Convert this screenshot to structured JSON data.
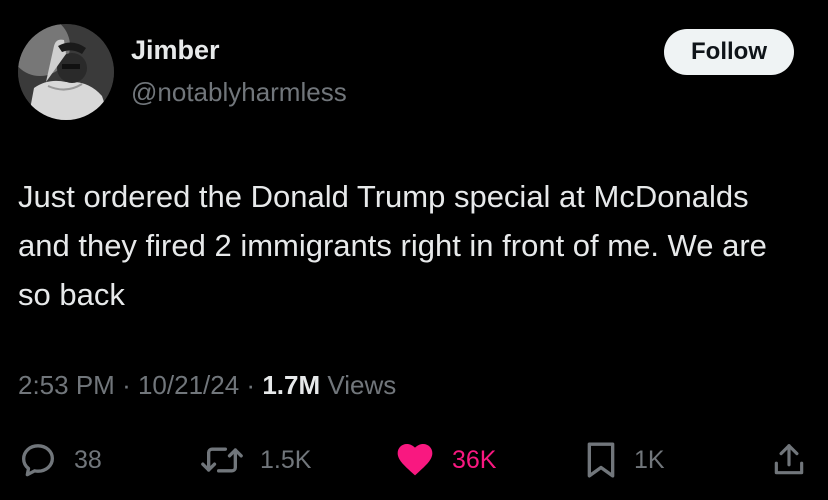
{
  "author": {
    "name": "Jimber",
    "handle": "@notablyharmless"
  },
  "follow_button": {
    "label": "Follow"
  },
  "tweet": {
    "text": "Just ordered the Donald Trump special at McDonalds and they fired 2 immigrants right in front of me. We are so back"
  },
  "meta": {
    "time": "2:53 PM",
    "separator": "·",
    "date": "10/21/24",
    "views_count": "1.7M",
    "views_label": "Views"
  },
  "actions": {
    "replies": "38",
    "reposts": "1.5K",
    "likes": "36K",
    "bookmarks": "1K"
  },
  "colors": {
    "background": "#000000",
    "text": "#e7e9ea",
    "secondary": "#71767b",
    "like": "#f91880",
    "follow_bg": "#eff3f4"
  },
  "icons": {
    "reply": "speech-bubble",
    "repost": "retweet-arrows",
    "like": "filled-heart",
    "bookmark": "bookmark",
    "share": "share-upload"
  }
}
